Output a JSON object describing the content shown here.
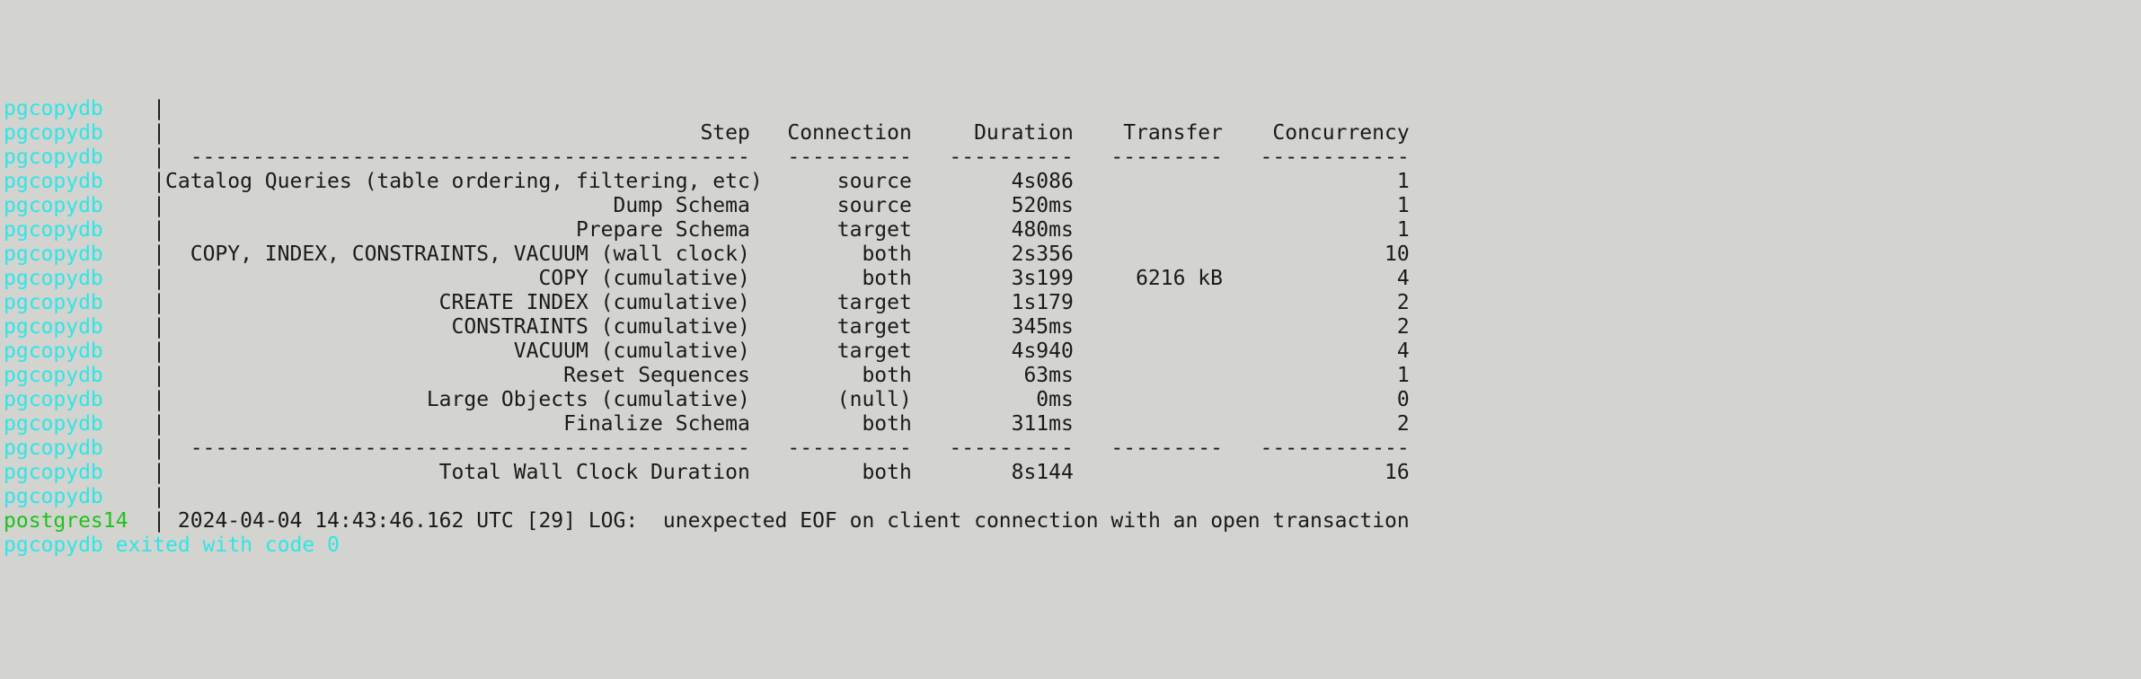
{
  "source_labels": {
    "pgcopydb": "pgcopydb",
    "postgres": "postgres14"
  },
  "pipe": "|",
  "headers": {
    "step": "Step",
    "connection": "Connection",
    "duration": "Duration",
    "transfer": "Transfer",
    "concurrency": "Concurrency"
  },
  "dashes": {
    "step": " ---------------------------------------------",
    "conn": "  ----------",
    "dur": "  ----------",
    "xfer": "  ---------",
    "conc": "  ------------"
  },
  "rows": [
    {
      "step": "Catalog Queries (table ordering, filtering, etc)",
      "conn": "source",
      "dur": "4s086",
      "xfer": "",
      "conc": "1"
    },
    {
      "step": "Dump Schema",
      "conn": "source",
      "dur": "520ms",
      "xfer": "",
      "conc": "1"
    },
    {
      "step": "Prepare Schema",
      "conn": "target",
      "dur": "480ms",
      "xfer": "",
      "conc": "1"
    },
    {
      "step": "COPY, INDEX, CONSTRAINTS, VACUUM (wall clock)",
      "conn": "both",
      "dur": "2s356",
      "xfer": "",
      "conc": "10"
    },
    {
      "step": "COPY (cumulative)",
      "conn": "both",
      "dur": "3s199",
      "xfer": "6216 kB",
      "conc": "4"
    },
    {
      "step": "CREATE INDEX (cumulative)",
      "conn": "target",
      "dur": "1s179",
      "xfer": "",
      "conc": "2"
    },
    {
      "step": "CONSTRAINTS (cumulative)",
      "conn": "target",
      "dur": "345ms",
      "xfer": "",
      "conc": "2"
    },
    {
      "step": "VACUUM (cumulative)",
      "conn": "target",
      "dur": "4s940",
      "xfer": "",
      "conc": "4"
    },
    {
      "step": "Reset Sequences",
      "conn": "both",
      "dur": "63ms",
      "xfer": "",
      "conc": "1"
    },
    {
      "step": "Large Objects (cumulative)",
      "conn": "(null)",
      "dur": "0ms",
      "xfer": "",
      "conc": "0"
    },
    {
      "step": "Finalize Schema",
      "conn": "both",
      "dur": "311ms",
      "xfer": "",
      "conc": "2"
    }
  ],
  "total": {
    "step": "Total Wall Clock Duration",
    "conn": "both",
    "dur": "8s144",
    "xfer": "",
    "conc": "16"
  },
  "postgres_log": "2024-04-04 14:43:46.162 UTC [29] LOG:  unexpected EOF on client connection with an open transaction",
  "exit_msg": "pgcopydb exited with code 0"
}
